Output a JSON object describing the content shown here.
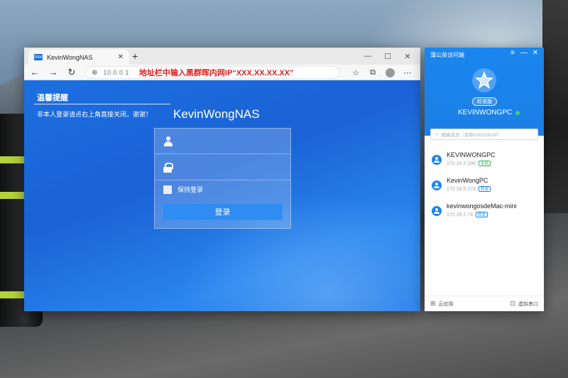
{
  "browser": {
    "tab": {
      "favicon": "DSM",
      "title": "KevinWongNAS",
      "close": "✕"
    },
    "new_tab": "+",
    "window_controls": [
      "—",
      "☐",
      "✕"
    ],
    "nav": {
      "back": "←",
      "forward": "→",
      "reload": "↻"
    },
    "address": {
      "url": "10.0.0.1",
      "overlay": "地址栏中输入黑群晖内网IP“XXX.XX.XX.XX”"
    },
    "toolbar_right": [
      "☆",
      "⧉",
      "⋯"
    ]
  },
  "page": {
    "notice_title": "温馨提醒",
    "notice_text": "非本人登录请点右上角直接关闭，谢谢！",
    "brand": "KevinWongNAS",
    "login": {
      "username_placeholder": "",
      "password_placeholder": "",
      "remember_label": "保持登录",
      "button_label": "登录"
    }
  },
  "client": {
    "title": "蒲公英访问端",
    "controls": [
      "≡",
      "—",
      "✕"
    ],
    "edition": "标准版",
    "device_name": "KEVINWONGPC",
    "status_color": "#3ed16f",
    "search_placeholder": "搜索成员（名称/UID/SID/IP）",
    "members": [
      {
        "name": "KEVINWONGPC",
        "ip": "172.16.2.100",
        "badge": "本机",
        "badge_type": "green"
      },
      {
        "name": "KevinWongPC",
        "ip": "172.16.5.173",
        "badge": "转发",
        "badge_type": "blue"
      },
      {
        "name": "kevinwongosdeMac-mini",
        "ip": "172.16.2.74",
        "badge": "转发",
        "badge_type": "blue"
      }
    ],
    "footer": {
      "apps": "云应用",
      "serial": "虚拟串口"
    }
  },
  "colors": {
    "accent": "#1a86ee",
    "page_bg": "#1d6fe0",
    "overlay_text": "#e0211f"
  }
}
